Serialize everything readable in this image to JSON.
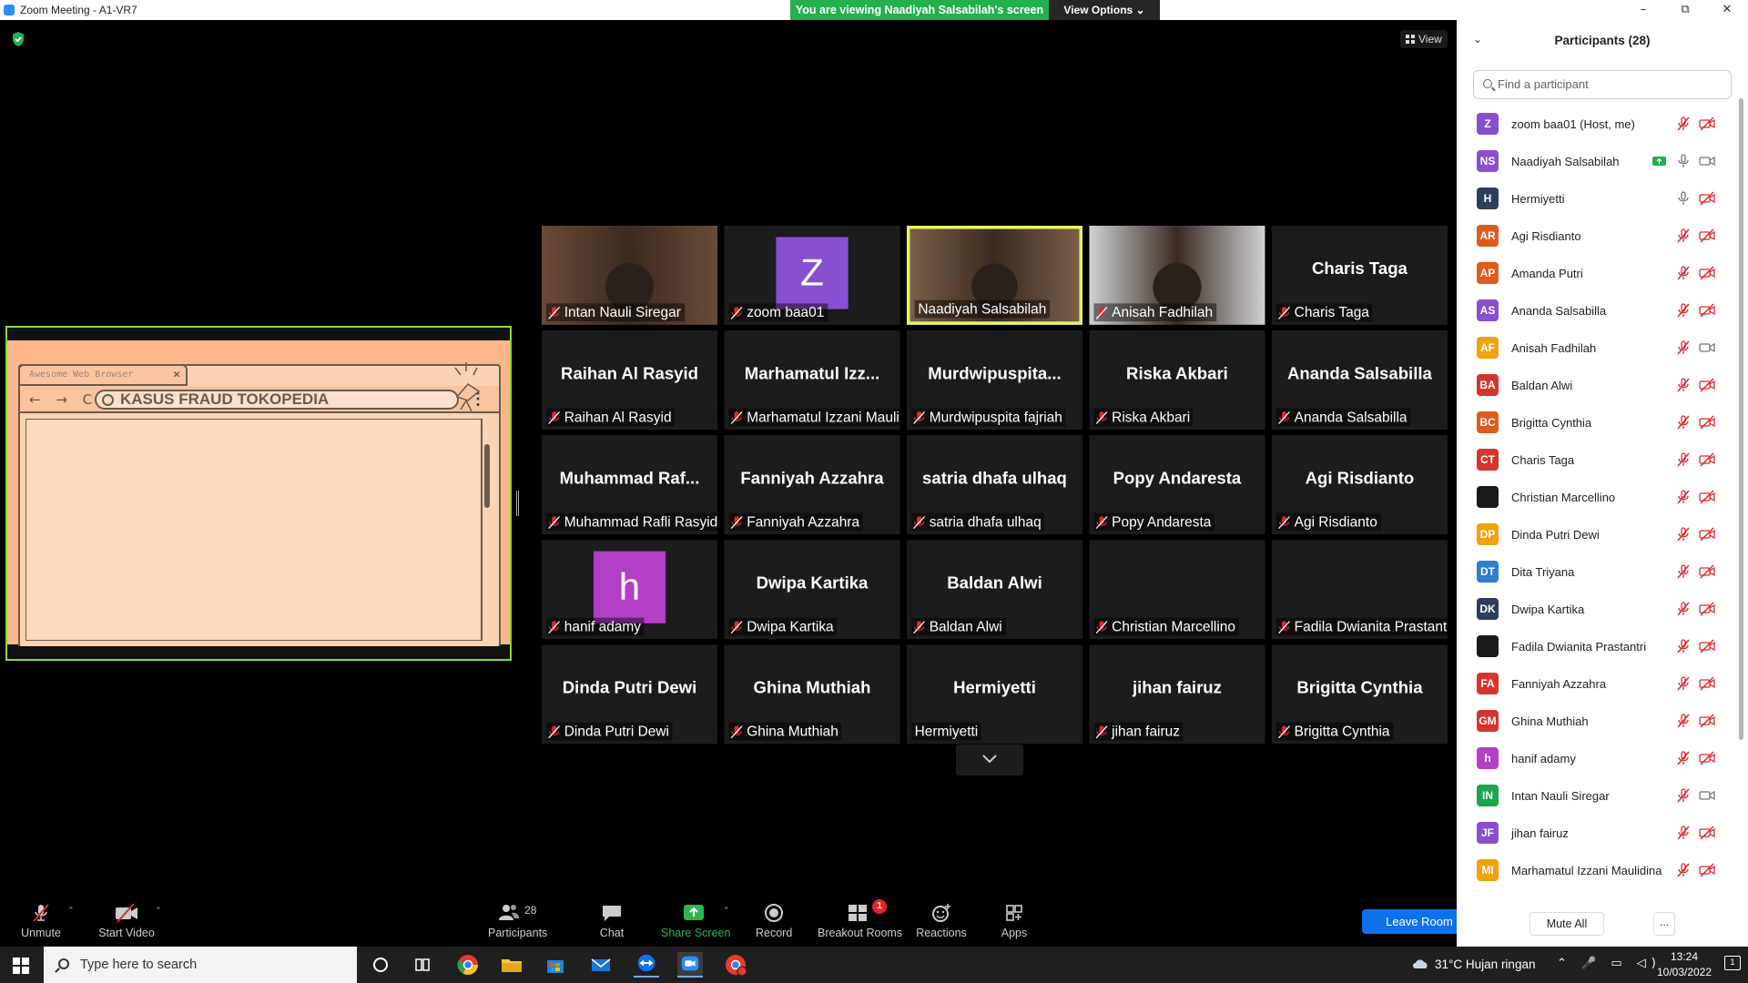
{
  "window": {
    "title": "Zoom Meeting - A1-VR7",
    "controls": [
      "–",
      "⧉",
      "✕"
    ]
  },
  "banner": {
    "message": "You are viewing Naadiyah Salsabilah's screen",
    "view_options": "View Options ⌄"
  },
  "view_button": "View",
  "shared_screen": {
    "tab_title": "Awesome Web Browser",
    "tab_close": "✕",
    "nav": "← → C",
    "url_text": "KASUS FRAUD TOKOPEDIA",
    "menu": "⋮"
  },
  "tiles": [
    {
      "big": "",
      "name": "Intan Nauli Siregar",
      "muted": true,
      "type": "cam",
      "cam_color": "#6b4a36"
    },
    {
      "big": "",
      "name": "zoom baa01",
      "muted": true,
      "type": "avatar",
      "letter": "Z",
      "color": "#8a4fd0"
    },
    {
      "big": "",
      "name": "Naadiyah Salsabilah",
      "muted": false,
      "type": "cam",
      "cam_color": "#7a5e48",
      "speaking": true
    },
    {
      "big": "",
      "name": "Anisah Fadhilah",
      "muted": true,
      "type": "cam",
      "cam_color": "#cfd2d5"
    },
    {
      "big": "Charis Taga",
      "name": "Charis Taga",
      "muted": true
    },
    {
      "big": "Raihan Al Rasyid",
      "name": "Raihan Al Rasyid",
      "muted": true
    },
    {
      "big": "Marhamatul  Izz...",
      "name": "Marhamatul Izzani Maulidina",
      "muted": true
    },
    {
      "big": "Murdwipuspita...",
      "name": "Murdwipuspita fajriah",
      "muted": true
    },
    {
      "big": "Riska Akbari",
      "name": "Riska Akbari",
      "muted": true
    },
    {
      "big": "Ananda Salsabilla",
      "name": "Ananda Salsabilla",
      "muted": true
    },
    {
      "big": "Muhammad  Raf...",
      "name": "Muhammad Rafli Rasyidin",
      "muted": true
    },
    {
      "big": "Fanniyah Azzahra",
      "name": "Fanniyah Azzahra",
      "muted": true
    },
    {
      "big": "satria dhafa ulhaq",
      "name": "satria dhafa ulhaq",
      "muted": true
    },
    {
      "big": "Popy Andaresta",
      "name": "Popy Andaresta",
      "muted": true
    },
    {
      "big": "Agi Risdianto",
      "name": "Agi Risdianto",
      "muted": true
    },
    {
      "big": "",
      "name": "hanif adamy",
      "muted": true,
      "type": "avatar",
      "letter": "h",
      "color": "#b23fc6"
    },
    {
      "big": "Dwipa Kartika",
      "name": "Dwipa Kartika",
      "muted": true
    },
    {
      "big": "Baldan Alwi",
      "name": "Baldan Alwi",
      "muted": true
    },
    {
      "big": "",
      "name": "Christian Marcellino",
      "muted": true
    },
    {
      "big": "",
      "name": "Fadila Dwianita Prastantri",
      "muted": true
    },
    {
      "big": "Dinda Putri Dewi",
      "name": "Dinda Putri Dewi",
      "muted": true
    },
    {
      "big": "Ghina Muthiah",
      "name": "Ghina Muthiah",
      "muted": true
    },
    {
      "big": "Hermiyetti",
      "name": "Hermiyetti",
      "muted": false
    },
    {
      "big": "jihan fairuz",
      "name": "jihan fairuz",
      "muted": true
    },
    {
      "big": "Brigitta Cynthia",
      "name": "Brigitta Cynthia",
      "muted": true
    }
  ],
  "toolbar": {
    "unmute": "Unmute",
    "start_video": "Start Video",
    "participants": "Participants",
    "participants_count": "28",
    "chat": "Chat",
    "share_screen": "Share Screen",
    "record": "Record",
    "breakout_rooms": "Breakout Rooms",
    "breakout_badge": "1",
    "reactions": "Reactions",
    "apps": "Apps",
    "leave": "Leave Room"
  },
  "panel": {
    "title": "Participants (28)",
    "search_placeholder": "Find a participant",
    "mute_all": "Mute All",
    "more": "...",
    "participants": [
      {
        "initials": "Z",
        "name": "zoom baa01 (Host, me)",
        "color": "#8a4fd0",
        "mic": "muted",
        "video": "off"
      },
      {
        "initials": "NS",
        "name": "Naadiyah Salsabilah",
        "color": "#8a4fd0",
        "mic": "on",
        "video": "on",
        "sharing": true
      },
      {
        "initials": "H",
        "name": "Hermiyetti",
        "color": "#2d3e5a",
        "mic": "on",
        "video": "off"
      },
      {
        "initials": "AR",
        "name": "Agi Risdianto",
        "color": "#e05a1c",
        "mic": "muted",
        "video": "off"
      },
      {
        "initials": "AP",
        "name": "Amanda Putri",
        "color": "#e05a1c",
        "mic": "muted",
        "video": "off"
      },
      {
        "initials": "AS",
        "name": "Ananda Salsabilla",
        "color": "#8a4fd0",
        "mic": "muted",
        "video": "off"
      },
      {
        "initials": "AF",
        "name": "Anisah Fadhilah",
        "color": "#f2a20d",
        "mic": "muted",
        "video": "on"
      },
      {
        "initials": "BA",
        "name": "Baldan Alwi",
        "color": "#d9342b",
        "mic": "muted",
        "video": "off"
      },
      {
        "initials": "BC",
        "name": "Brigitta Cynthia",
        "color": "#e05a1c",
        "mic": "muted",
        "video": "off"
      },
      {
        "initials": "CT",
        "name": "Charis Taga",
        "color": "#d9342b",
        "mic": "muted",
        "video": "off"
      },
      {
        "initials": "",
        "name": "Christian Marcellino",
        "color": "#1a1a1a",
        "mic": "muted",
        "video": "off"
      },
      {
        "initials": "DP",
        "name": "Dinda Putri Dewi",
        "color": "#f2a20d",
        "mic": "muted",
        "video": "off"
      },
      {
        "initials": "DT",
        "name": "Dita Triyana",
        "color": "#2b7fd4",
        "mic": "muted",
        "video": "off"
      },
      {
        "initials": "DK",
        "name": "Dwipa Kartika",
        "color": "#2d3e5a",
        "mic": "muted",
        "video": "off"
      },
      {
        "initials": "",
        "name": "Fadila Dwianita Prastantri",
        "color": "#1a1a1a",
        "mic": "muted",
        "video": "off"
      },
      {
        "initials": "FA",
        "name": "Fanniyah Azzahra",
        "color": "#d9342b",
        "mic": "muted",
        "video": "off"
      },
      {
        "initials": "GM",
        "name": "Ghina Muthiah",
        "color": "#d9342b",
        "mic": "muted",
        "video": "off"
      },
      {
        "initials": "h",
        "name": "hanif adamy",
        "color": "#b23fc6",
        "mic": "muted",
        "video": "off"
      },
      {
        "initials": "IN",
        "name": "Intan Nauli Siregar",
        "color": "#1aa64b",
        "mic": "muted",
        "video": "on"
      },
      {
        "initials": "JF",
        "name": "jihan fairuz",
        "color": "#8a4fd0",
        "mic": "muted",
        "video": "off"
      },
      {
        "initials": "MI",
        "name": "Marhamatul Izzani Maulidina",
        "color": "#f2a20d",
        "mic": "muted",
        "video": "off"
      }
    ]
  },
  "taskbar": {
    "search_placeholder": "Type here to search",
    "weather": "31°C  Hujan ringan",
    "time": "13:24",
    "date": "10/03/2022",
    "notif_count": "1",
    "tray_icons": "⌃ 🎤 ▭ ◁)"
  },
  "colors": {
    "accent": "#0e72ed",
    "share_green": "#23b04d",
    "speaking": "#e3f26a",
    "muted_red": "#e02828"
  }
}
